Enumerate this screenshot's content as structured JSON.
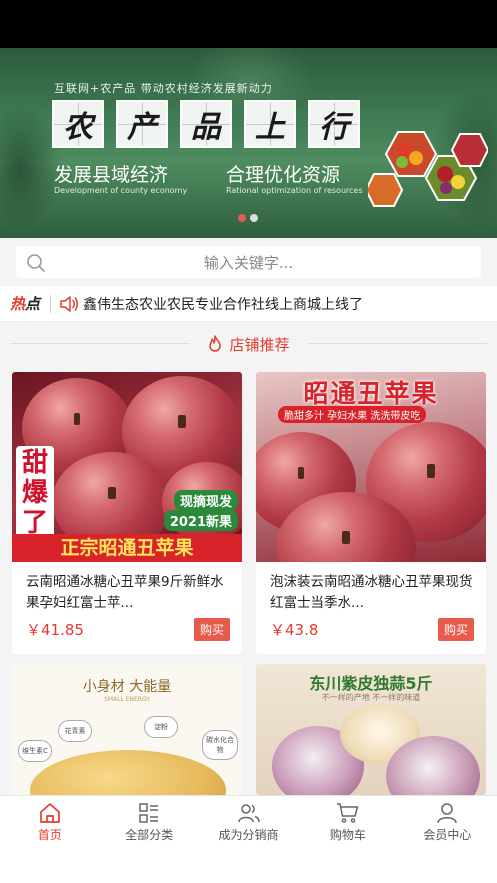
{
  "banner": {
    "subtitle": "互联网+农产品 带动农村经济发展新动力",
    "title_chars": [
      "农",
      "产",
      "品",
      "上",
      "行"
    ],
    "slogan_left": "发展县域经济",
    "slogan_left_en": "Development of county economy",
    "slogan_right": "合理优化资源",
    "slogan_right_en": "Rational optimization of resources",
    "pagination_active_color": "#e85a4b"
  },
  "search": {
    "placeholder": "输入关键字...",
    "icon": "search-icon"
  },
  "hot": {
    "label_prefix": "热",
    "label_suffix": "点",
    "icon": "speaker-icon",
    "text": "鑫伟生态农业农民专业合作社线上商城上线了"
  },
  "section": {
    "icon": "flame-icon",
    "title": "店铺推荐"
  },
  "products": [
    {
      "name": "云南昭通冰糖心丑苹果9斤新鲜水果孕妇红富士苹...",
      "price": "￥41.85",
      "buy_label": "购买",
      "image_overlay": {
        "side_text": "甜爆了",
        "badge_top": "现摘现发",
        "badge_bottom": "2021新果",
        "footer": "正宗昭通丑苹果"
      }
    },
    {
      "name": "泡沫装云南昭通冰糖心丑苹果现货红富士当季水...",
      "price": "￥43.8",
      "buy_label": "购买",
      "image_overlay": {
        "title": "昭通丑苹果",
        "tagline": "脆甜多汁 孕妇水果 洗洗带皮吃"
      }
    },
    {
      "name": "",
      "price": "",
      "image_overlay": {
        "title": "小身材 大能量",
        "subtitle": "SMALL ENERGY",
        "bubbles": [
          "维生素C",
          "花青素",
          "淀粉",
          "碳水化合物"
        ]
      }
    },
    {
      "name": "",
      "price": "",
      "image_overlay": {
        "title": "东川紫皮独蒜5斤",
        "subtitle": "不一样的产地  不一样的味道"
      }
    }
  ],
  "nav": [
    {
      "label": "首页",
      "icon": "home-icon",
      "active": true
    },
    {
      "label": "全部分类",
      "icon": "category-icon",
      "active": false
    },
    {
      "label": "成为分销商",
      "icon": "distributor-icon",
      "active": false
    },
    {
      "label": "购物车",
      "icon": "cart-icon",
      "active": false
    },
    {
      "label": "会员中心",
      "icon": "member-icon",
      "active": false
    }
  ],
  "colors": {
    "accent": "#e53b2e",
    "buy_button": "#e85a4b"
  }
}
